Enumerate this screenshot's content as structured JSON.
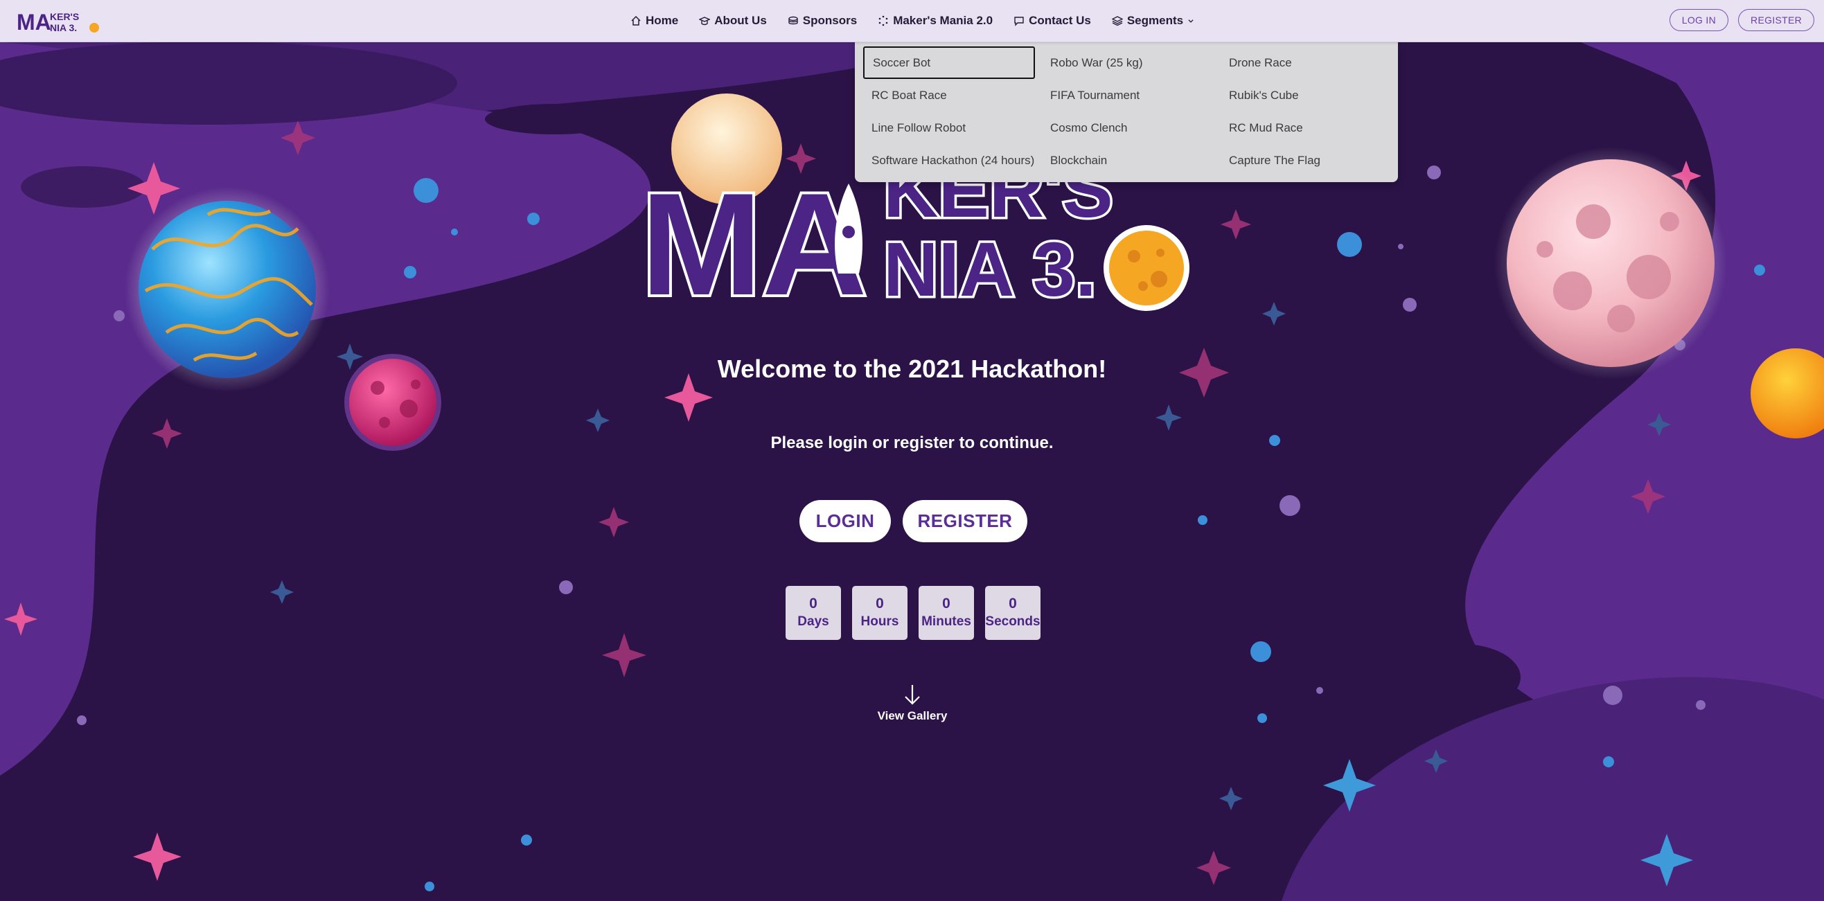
{
  "brand": {
    "logo_top": "KER'S",
    "logo_bottom": "NIA 3.",
    "logo_prefix": "MA"
  },
  "nav": {
    "links": [
      {
        "label": "Home",
        "icon": "home-icon"
      },
      {
        "label": "About Us",
        "icon": "graduation-cap-icon"
      },
      {
        "label": "Sponsors",
        "icon": "coins-icon"
      },
      {
        "label": "Maker's Mania 2.0",
        "icon": "dotted-circle-icon"
      },
      {
        "label": "Contact Us",
        "icon": "chat-bubble-icon"
      },
      {
        "label": "Segments",
        "icon": "layers-icon"
      }
    ],
    "login_label": "LOG IN",
    "register_label": "REGISTER"
  },
  "segments": {
    "col1": [
      "Soccer Bot",
      "RC Boat Race",
      "Line Follow Robot",
      "Software Hackathon (24 hours)"
    ],
    "col2": [
      "Robo War (25 kg)",
      "FIFA Tournament",
      "Cosmo Clench",
      "Blockchain"
    ],
    "col3": [
      "Drone Race",
      "Rubik's Cube",
      "RC Mud Race",
      "Capture The Flag"
    ]
  },
  "hero": {
    "logo_line1": "KER'S",
    "logo_line2": "NIA 3.",
    "logo_big": "MA",
    "welcome": "Welcome to the 2021 Hackathon!",
    "subtitle": "Please login or register to continue.",
    "login_label": "LOGIN",
    "register_label": "REGISTER"
  },
  "countdown": [
    {
      "value": "0",
      "label": "Days"
    },
    {
      "value": "0",
      "label": "Hours"
    },
    {
      "value": "0",
      "label": "Minutes"
    },
    {
      "value": "0",
      "label": "Seconds"
    }
  ],
  "gallery": {
    "label": "View Gallery",
    "icon": "arrow-down-icon"
  },
  "colors": {
    "accent": "#5b2d99",
    "background": "#2a1245",
    "navbar": "#e9e2f2"
  }
}
